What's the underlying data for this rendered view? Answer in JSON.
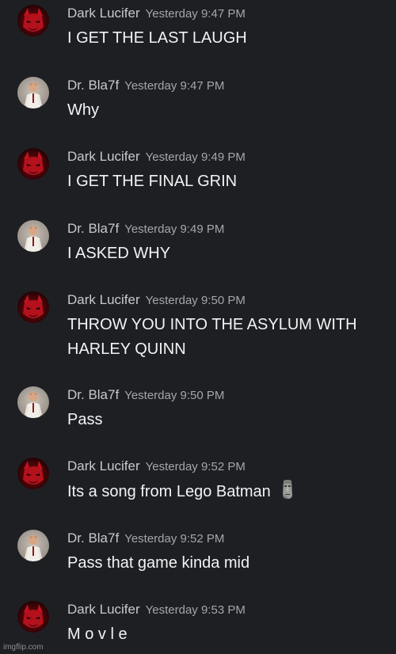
{
  "messages": [
    {
      "author": "Dark Lucifer",
      "timestamp": "Yesterday 9:47 PM",
      "text": "I GET THE LAST LAUGH",
      "avatar_icon": "red-demon-avatar"
    },
    {
      "author": "Dr. Bla7f",
      "timestamp": "Yesterday 9:47 PM",
      "text": "Why",
      "avatar_icon": "figure-avatar"
    },
    {
      "author": "Dark Lucifer",
      "timestamp": "Yesterday 9:49 PM",
      "text": "I GET THE FINAL GRIN",
      "avatar_icon": "red-demon-avatar"
    },
    {
      "author": "Dr. Bla7f",
      "timestamp": "Yesterday 9:49 PM",
      "text": "I ASKED WHY",
      "avatar_icon": "figure-avatar"
    },
    {
      "author": "Dark Lucifer",
      "timestamp": "Yesterday 9:50 PM",
      "text": "THROW YOU INTO THE ASYLUM WITH HARLEY QUINN",
      "avatar_icon": "red-demon-avatar"
    },
    {
      "author": "Dr. Bla7f",
      "timestamp": "Yesterday 9:50 PM",
      "text": "Pass",
      "avatar_icon": "figure-avatar"
    },
    {
      "author": "Dark Lucifer",
      "timestamp": "Yesterday 9:52 PM",
      "text": "Its a song from Lego Batman",
      "avatar_icon": "red-demon-avatar",
      "emoji": "moai-emoji-icon"
    },
    {
      "author": "Dr. Bla7f",
      "timestamp": "Yesterday 9:52 PM",
      "text": "Pass that game kinda mid",
      "avatar_icon": "figure-avatar"
    },
    {
      "author": "Dark Lucifer",
      "timestamp": "Yesterday 9:53 PM",
      "text": "M o v l e",
      "avatar_icon": "red-demon-avatar"
    }
  ],
  "watermark": "imgflip.com",
  "colors": {
    "background": "#1e1f23",
    "message_text": "#f2f3f5",
    "author": "#c7c9cd",
    "timestamp": "#a3a6ab",
    "demon_red": "#b3111c"
  }
}
